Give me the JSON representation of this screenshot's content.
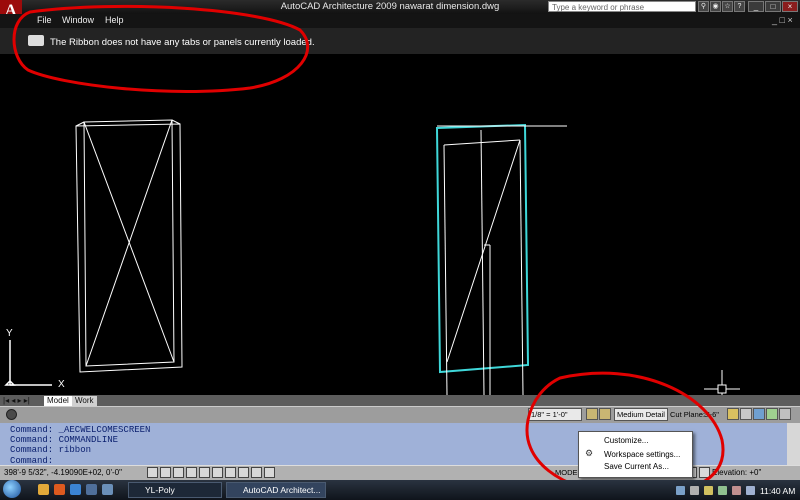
{
  "window": {
    "title": "AutoCAD Architecture 2009  nawarat dimension.dwg",
    "search_placeholder": "Type a keyword or phrase"
  },
  "menubar": {
    "items": [
      "File",
      "Window",
      "Help"
    ]
  },
  "ribbon": {
    "message": "The Ribbon does not have any tabs or panels currently loaded."
  },
  "layout_tabs": [
    "Model",
    "Work"
  ],
  "drawing_toolbar": {
    "scale": "1/8\" = 1'-0\"",
    "detail": "Medium Detail",
    "cut_plane_label": "Cut Plane:",
    "cut_plane_value": "3'-6\""
  },
  "command_lines": [
    "Command:  _AECWELCOMESCREEN",
    "Command:  COMMANDLINE",
    "Command:  ribbon",
    "Command:"
  ],
  "status_bar": {
    "coordinates": "398'-9 5/32\", -4.19090E+02, 0'-0\"",
    "model_label": "MODEL",
    "elevation": "Elevation: +0\""
  },
  "context_menu": {
    "items": [
      "Customize...",
      "Workspace settings...",
      "Save Current As..."
    ]
  },
  "ucs": {
    "x_label": "X",
    "y_label": "Y"
  },
  "taskbar": {
    "buttons": [
      "YL-Poly",
      "AutoCAD Architect..."
    ],
    "clock": "11:40 AM"
  },
  "colors": {
    "annotation_red": "#e00000",
    "door_cyan": "#3fd7d9",
    "canvas": "#000000"
  }
}
